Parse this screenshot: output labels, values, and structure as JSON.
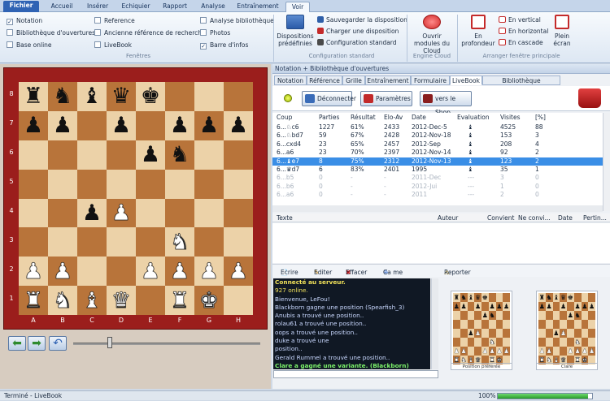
{
  "tabs": [
    "Fichier",
    "Accueil",
    "Insérer",
    "Echiquier",
    "Rapport",
    "Analyse",
    "Entraînement",
    "Voir"
  ],
  "ribbon": {
    "col1": [
      "Notation",
      "Bibliothèque d'ouvertures",
      "Base online"
    ],
    "col1_checked": [
      true,
      false,
      false
    ],
    "col2": [
      "Reference",
      "Ancienne référence de recherche",
      "LiveBook"
    ],
    "col2_checked": [
      false,
      false,
      false
    ],
    "col3": [
      "Analyse bibliothèque",
      "Photos",
      "Barre d'infos"
    ],
    "col3_checked": [
      false,
      false,
      true
    ],
    "fenetres_label": "Fenêtres",
    "dispositions": "Dispositions prédéfinies",
    "save_layout": "Sauvegarder la disposition",
    "load_layout": "Charger une disposition",
    "std_config": "Configuration standard",
    "config_group": "Configuration standard",
    "open_cloud": "Ouvrir modules du Cloud",
    "engine_cloud": "Engine Cloud",
    "depth": "En profondeur",
    "vertical": "En vertical",
    "horizontal": "En horizontal",
    "cascade": "En cascade",
    "fullscreen": "Plein écran",
    "arrange_group": "Arranger fenêtre principale"
  },
  "board": {
    "ranks": [
      "8",
      "7",
      "6",
      "5",
      "4",
      "3",
      "2",
      "1"
    ],
    "files": [
      "A",
      "B",
      "C",
      "D",
      "E",
      "F",
      "G",
      "H"
    ],
    "rows": [
      [
        "bR",
        "bN",
        "bB",
        "bQ",
        "bK",
        "",
        "",
        ""
      ],
      [
        "bP",
        "bP",
        "",
        "bP",
        "",
        "bP",
        "bP",
        "bP"
      ],
      [
        "",
        "",
        "",
        "",
        "bP",
        "bN",
        "",
        ""
      ],
      [
        "",
        "",
        "",
        "",
        "",
        "",
        "",
        ""
      ],
      [
        "",
        "",
        "bP",
        "wP",
        "",
        "",
        "",
        ""
      ],
      [
        "",
        "",
        "",
        "",
        "",
        "wN",
        "",
        ""
      ],
      [
        "wP",
        "wP",
        "",
        "",
        "wP",
        "wP",
        "wP",
        "wP"
      ],
      [
        "wR",
        "wN",
        "wB",
        "wQ",
        "",
        "wR",
        "wK",
        ""
      ]
    ]
  },
  "panel": {
    "title": "Notation + Bibliothèque d'ouvertures",
    "tabs": [
      "Notation",
      "Référence",
      "Grille",
      "Entraînement",
      "Formulaire",
      "LiveBook",
      "Bibliothèque d'ouvertures"
    ],
    "active_tab": "LiveBook",
    "disconnect": "Déconnecter",
    "params": "Paramètres",
    "shop": "vers le Shop"
  },
  "table": {
    "headers": [
      "Coup",
      "Parties",
      "Résultat",
      "Elo-Av",
      "Date",
      "Evaluation",
      "Visites",
      "[%]"
    ],
    "rows": [
      {
        "coup": "6...♘c6",
        "parties": "1227",
        "resultat": "61%",
        "elo": "2433",
        "date": "2012-Dec-5",
        "eval": "♝",
        "visites": "4525",
        "pct": "88",
        "state": "normal"
      },
      {
        "coup": "6...♘bd7",
        "parties": "59",
        "resultat": "67%",
        "elo": "2428",
        "date": "2012-Nov-18",
        "eval": "♝",
        "visites": "153",
        "pct": "3",
        "state": "normal"
      },
      {
        "coup": "6...cxd4",
        "parties": "23",
        "resultat": "65%",
        "elo": "2457",
        "date": "2012-Sep",
        "eval": "♝",
        "visites": "208",
        "pct": "4",
        "state": "normal"
      },
      {
        "coup": "6...a6",
        "parties": "23",
        "resultat": "70%",
        "elo": "2397",
        "date": "2012-Nov-14",
        "eval": "♝",
        "visites": "92",
        "pct": "2",
        "state": "normal"
      },
      {
        "coup": "6...♝e7",
        "parties": "8",
        "resultat": "75%",
        "elo": "2312",
        "date": "2012-Nov-13",
        "eval": "♝",
        "visites": "123",
        "pct": "2",
        "state": "selected"
      },
      {
        "coup": "6...♛d7",
        "parties": "6",
        "resultat": "83%",
        "elo": "2401",
        "date": "1995",
        "eval": "♝",
        "visites": "35",
        "pct": "1",
        "state": "normal"
      },
      {
        "coup": "6...b5",
        "parties": "0",
        "resultat": "-",
        "elo": "-",
        "date": "2011-Dec",
        "eval": "---",
        "visites": "3",
        "pct": "0",
        "state": "dim"
      },
      {
        "coup": "6...b6",
        "parties": "0",
        "resultat": "-",
        "elo": "-",
        "date": "2012-Jui",
        "eval": "---",
        "visites": "1",
        "pct": "0",
        "state": "dim"
      },
      {
        "coup": "6...a6",
        "parties": "0",
        "resultat": "-",
        "elo": "-",
        "date": "2011",
        "eval": "---",
        "visites": "2",
        "pct": "0",
        "state": "dim"
      }
    ]
  },
  "comments": {
    "headers": [
      "Texte",
      "Auteur",
      "Convient",
      "Ne convi...",
      "Date",
      "Pertin..."
    ],
    "write": "Ecrire",
    "edit": "Editer",
    "delete": "Effacer",
    "like": "Ca me convient",
    "report": "Reporter"
  },
  "chat": [
    {
      "text": "Connecté au serveur.",
      "color": "#f2e25a",
      "bold": true
    },
    {
      "text": "927 online.",
      "color": "#f2e25a",
      "bold": false
    },
    {
      "text": "Bienvenue, LeFou!",
      "color": "#c9d8ff",
      "bold": false
    },
    {
      "text": "Blackborn gagne une position (Spearfish_3)",
      "color": "#c9d8ff",
      "bold": false
    },
    {
      "text": "Anubis a trouvé une position..",
      "color": "#c9d8ff",
      "bold": false
    },
    {
      "text": "rolau61 a trouvé une position..",
      "color": "#c9d8ff",
      "bold": false
    },
    {
      "text": "oops a trouvé une position..",
      "color": "#c9d8ff",
      "bold": false
    },
    {
      "text": "duke a trouvé une",
      "color": "#c9d8ff",
      "bold": false
    },
    {
      "text": "position..",
      "color": "#c9d8ff",
      "bold": false
    },
    {
      "text": "Gerald Rummel a trouvé une position..",
      "color": "#c9d8ff",
      "bold": false
    },
    {
      "text": "Clare a gagné une variante. (Blackborn)",
      "color": "#7cf26a",
      "bold": true
    }
  ],
  "thumbs": [
    {
      "caption": "Position préférée"
    },
    {
      "caption": "Clare"
    }
  ],
  "status": {
    "text": "Terminé - LiveBook",
    "zoom": "100%",
    "progress": 0.96
  }
}
